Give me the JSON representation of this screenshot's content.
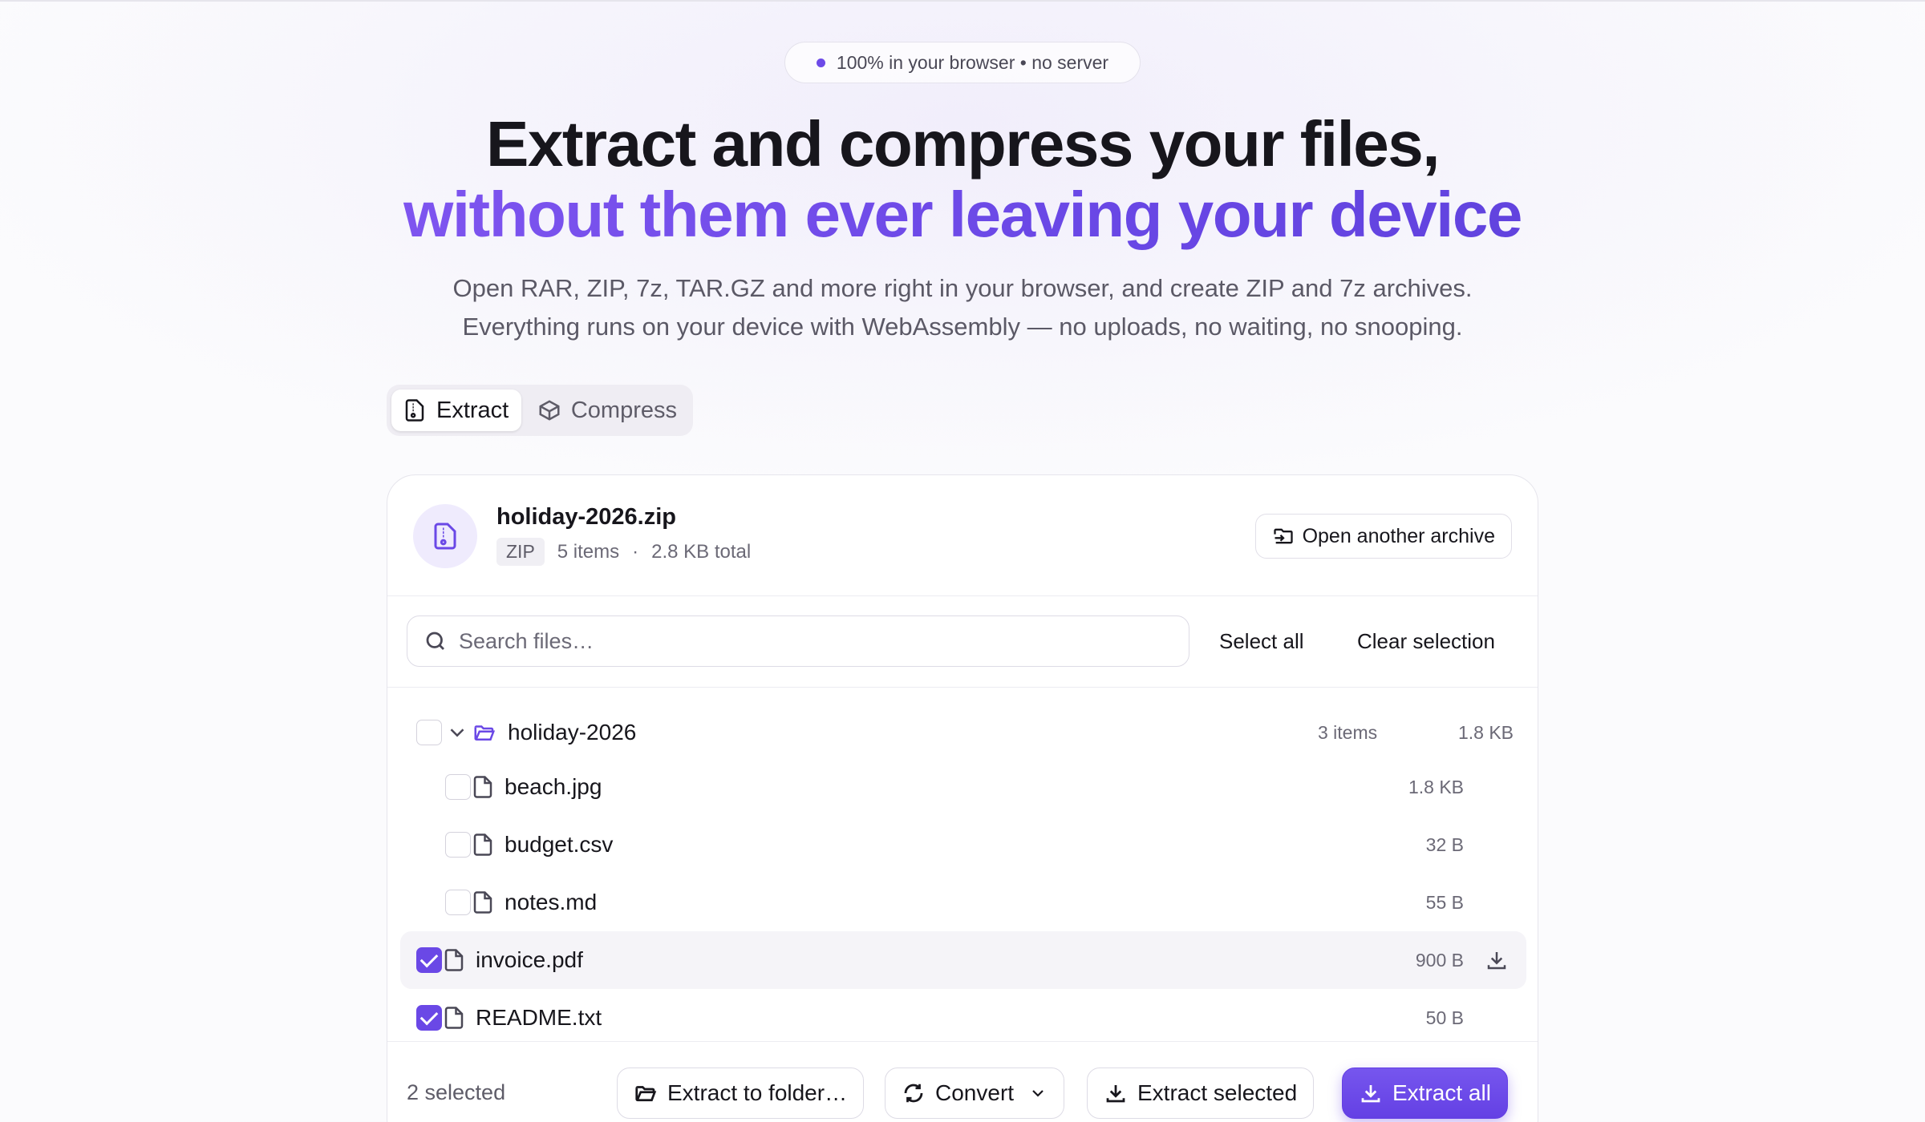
{
  "badge_pill": {
    "text": "100% in your browser • no server",
    "accent": "#6d4ae8"
  },
  "hero": {
    "title_line1": "Extract and compress your files,",
    "title_line2": "without them ever leaving your device",
    "sub_line1": "Open RAR, ZIP, 7z, TAR.GZ and more right in your browser, and create ZIP and 7z archives.",
    "sub_line2": "Everything runs on your device with WebAssembly — no uploads, no waiting, no snooping."
  },
  "tabs": [
    {
      "label": "Extract",
      "active": true,
      "icon": "file-archive-icon"
    },
    {
      "label": "Compress",
      "active": false,
      "icon": "package-icon"
    }
  ],
  "archive": {
    "name": "holiday-2026.zip",
    "format": "ZIP",
    "items": "5 items",
    "separator": "·",
    "total": "2.8 KB total",
    "open_another_label": "Open another archive"
  },
  "toolbar": {
    "search_placeholder": "Search files…",
    "select_all_label": "Select all",
    "clear_selection_label": "Clear selection"
  },
  "tree": {
    "folder": {
      "name": "holiday-2026",
      "count": "3 items",
      "size": "1.8 KB",
      "checked": false
    },
    "folder_files": [
      {
        "name": "beach.jpg",
        "size": "1.8 KB",
        "checked": false
      },
      {
        "name": "budget.csv",
        "size": "32 B",
        "checked": false
      },
      {
        "name": "notes.md",
        "size": "55 B",
        "checked": false
      }
    ],
    "root_files": [
      {
        "name": "invoice.pdf",
        "size": "900 B",
        "checked": true
      },
      {
        "name": "README.txt",
        "size": "50 B",
        "checked": true
      }
    ]
  },
  "footer": {
    "selected_count": "2 selected",
    "extract_to_folder_label": "Extract to folder…",
    "convert_label": "Convert",
    "extract_selected_label": "Extract selected",
    "extract_all_label": "Extract all"
  },
  "colors": {
    "accent": "#6a48e6",
    "accent_light": "#efebfd"
  }
}
